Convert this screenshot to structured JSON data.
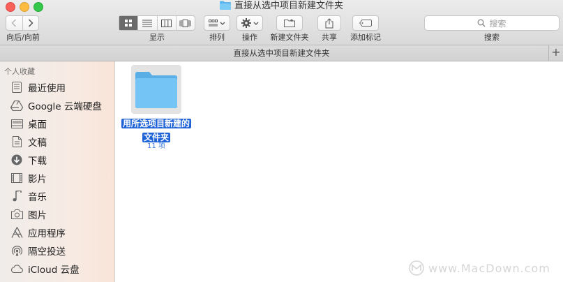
{
  "window": {
    "title": "直接从选中项目新建文件夹"
  },
  "toolbar": {
    "nav_label": "向后/向前",
    "view_label": "显示",
    "arrange_label": "排列",
    "action_label": "操作",
    "new_folder_label": "新建文件夹",
    "share_label": "共享",
    "tags_label": "添加标记",
    "search_label": "搜索",
    "search_placeholder": "搜索"
  },
  "pathbar": {
    "title": "直接从选中项目新建文件夹"
  },
  "sidebar": {
    "header": "个人收藏",
    "items": [
      {
        "label": "最近使用",
        "icon": "recents-icon"
      },
      {
        "label": "Google 云端硬盘",
        "icon": "google-drive-icon"
      },
      {
        "label": "桌面",
        "icon": "desktop-icon"
      },
      {
        "label": "文稿",
        "icon": "documents-icon"
      },
      {
        "label": "下载",
        "icon": "downloads-icon"
      },
      {
        "label": "影片",
        "icon": "movies-icon"
      },
      {
        "label": "音乐",
        "icon": "music-icon"
      },
      {
        "label": "图片",
        "icon": "pictures-icon"
      },
      {
        "label": "应用程序",
        "icon": "applications-icon"
      },
      {
        "label": "隔空投送",
        "icon": "airdrop-icon"
      },
      {
        "label": "iCloud 云盘",
        "icon": "icloud-icon"
      }
    ]
  },
  "content": {
    "folder": {
      "name_line1": "用所选项目新建的",
      "name_line2": "文件夹",
      "count": "11 项"
    }
  },
  "watermark": {
    "text": "www.MacDown.com"
  },
  "colors": {
    "selection": "#1d62d6",
    "folder": "#6fc0f2",
    "count": "#3a7be0"
  }
}
